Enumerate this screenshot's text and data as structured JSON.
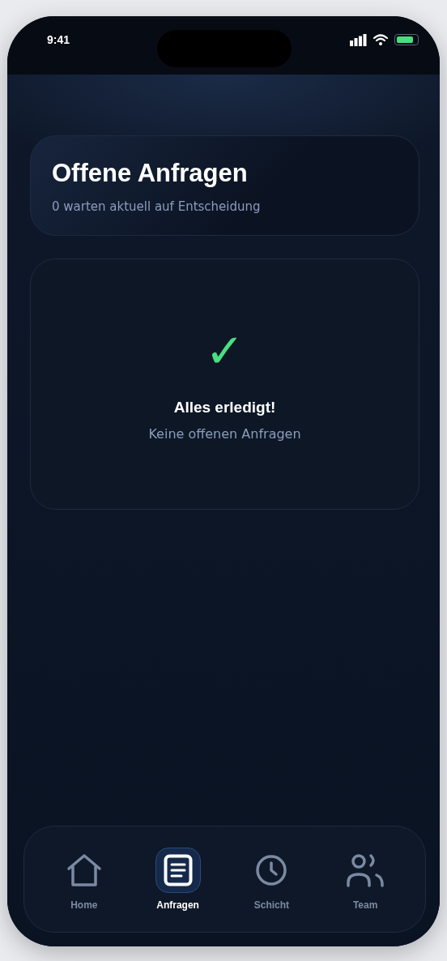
{
  "status_bar": {
    "time": "9:41"
  },
  "header": {
    "title": "Offene Anfragen",
    "subtitle": "0 warten aktuell auf Entscheidung"
  },
  "empty_state": {
    "mark": "✓",
    "title": "Alles erledigt!",
    "message": "Keine offenen Anfragen"
  },
  "nav": [
    {
      "kind": "home",
      "label": "Home",
      "selected": false
    },
    {
      "kind": "requests",
      "label": "Anfragen",
      "selected": true
    },
    {
      "kind": "shift",
      "label": "Schicht",
      "selected": false
    },
    {
      "kind": "team",
      "label": "Team",
      "selected": false
    }
  ]
}
